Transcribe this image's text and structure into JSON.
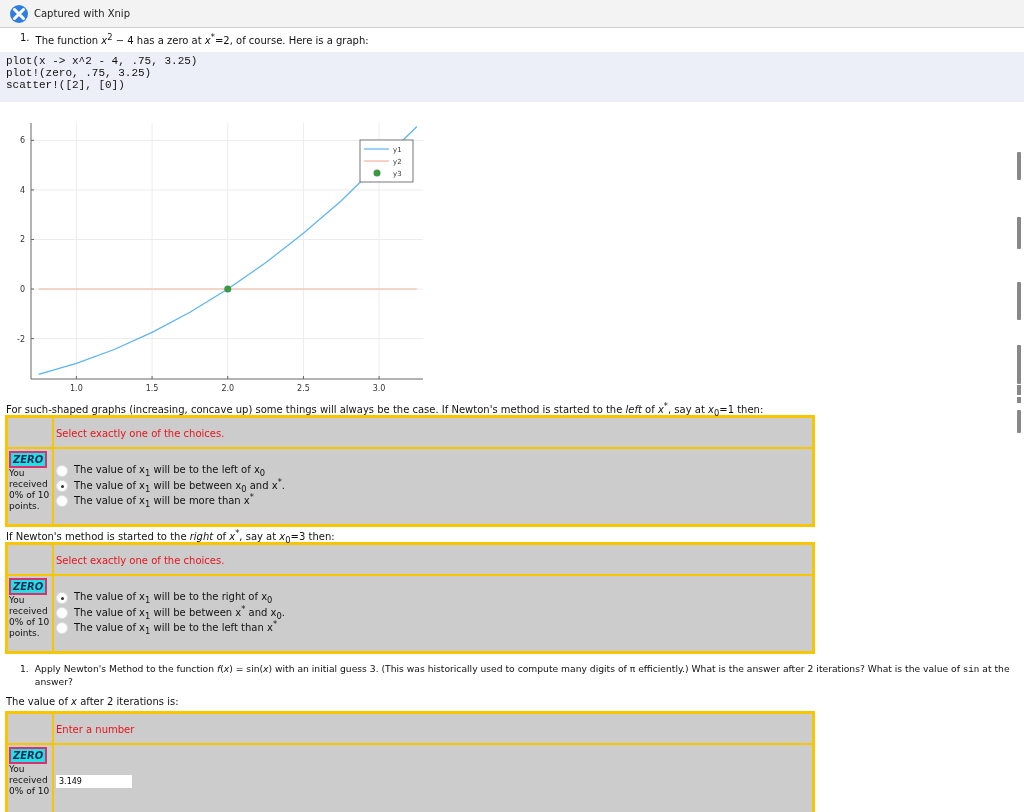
{
  "capture_bar": {
    "label": "Captured with Xnip"
  },
  "intro": {
    "number": "1.",
    "text": "The function *x*$^{2}$ − 4 has a zero at *x*$^{*}$=2, of course. Here is a graph:"
  },
  "code": [
    "plot(x -> x^2 - 4, .75, 3.25)",
    "plot!(zero, .75, 3.25)",
    "scatter!([2], [0])"
  ],
  "chart": {
    "chart_data": {
      "type": "line",
      "x": [
        0.75,
        1,
        1.25,
        1.5,
        1.75,
        2,
        2.25,
        2.5,
        2.75,
        3,
        3.25
      ],
      "xlim": [
        0.7,
        3.29
      ],
      "ylim": [
        -3.63,
        6.7
      ],
      "xticks": [
        {
          "value": 1,
          "label": "1.0"
        },
        {
          "value": 1.5,
          "label": "1.5"
        },
        {
          "value": 2,
          "label": "2.0"
        },
        {
          "value": 2.5,
          "label": "2.5"
        },
        {
          "value": 3,
          "label": "3.0"
        }
      ],
      "yticks": [
        -2,
        0,
        2,
        4,
        6
      ],
      "grid": true,
      "legend": true,
      "series": [
        {
          "name": "y1",
          "color": "#5ab4ef",
          "values": [
            -3.44,
            -3,
            -2.44,
            -1.75,
            -0.94,
            0,
            1.06,
            2.25,
            3.56,
            null,
            6.56
          ]
        },
        {
          "name": "y2",
          "color": "#f4b29c",
          "values": [
            0,
            0,
            0,
            0,
            0,
            0,
            0,
            0,
            0,
            0,
            0
          ]
        },
        {
          "name": "y3",
          "color": "#3a9a44",
          "type": "scatter",
          "values": [
            null,
            null,
            null,
            null,
            null,
            0,
            null,
            null,
            null,
            null,
            null
          ]
        }
      ]
    }
  },
  "questions": [
    {
      "prompt": "For such-shaped graphs (increasing, concave up) some things will always be the case. If Newton's method is started to the *left* of *x*$^{*}$, say at *x*$_{0}$=1 then:",
      "instruction": "Select exactly one of the choices.",
      "badge": "ZERO",
      "score": "You received 0% of 10 points.",
      "kind": "choice",
      "choices": [
        {
          "label": "The value of x$_{1}$ will be to the left of x$_{0}$",
          "selected": false
        },
        {
          "label": "The value of x$_{1}$ will be between x$_{0}$ and x$^{*}$.",
          "selected": true
        },
        {
          "label": "The value of x$_{1}$ will be more than x$^{*}$",
          "selected": false
        }
      ]
    },
    {
      "prompt": "If Newton's method is started to the *right* of *x*$^{*}$, say at *x*$_{0}$=3 then:",
      "instruction": "Select exactly one of the choices.",
      "badge": "ZERO",
      "score": "You received 0% of 10 points.",
      "kind": "choice",
      "choices": [
        {
          "label": "The value of x$_{1}$ will be to the right of x$_{0}$",
          "selected": true
        },
        {
          "label": "The value of x$_{1}$ will be between x$^{*}$ and x$_{0}$.",
          "selected": false
        },
        {
          "label": "The value of x$_{1}$ will be to the left than x$^{*}$",
          "selected": false
        }
      ]
    },
    {
      "number": "1.",
      "problem": {
        "before": "Apply Newton's Method to the function *f*(*x*) = sin(*x*) with an initial guess 3. (This was historically used to compute many digits of π efficiently.) What is the answer after 2 iterations? What is the value of",
        "code": "sin",
        "after": "at the answer?"
      },
      "prompt": "The value of *x* after 2 iterations is:",
      "instruction": "Enter a number",
      "badge": "ZERO",
      "score": "You received 0% of 10",
      "kind": "number",
      "value": "3.149"
    }
  ]
}
